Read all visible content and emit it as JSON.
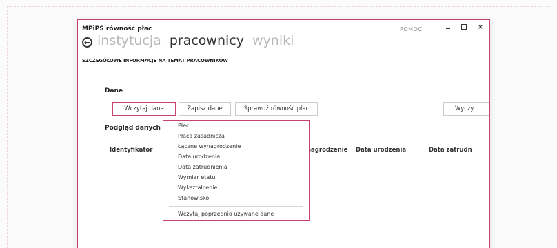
{
  "window": {
    "title": "MPiPS równość płac",
    "help": "POMOC",
    "minimize": "minimize",
    "maximize": "maximize",
    "close": "×"
  },
  "nav": {
    "back_icon": "back-arrow-icon",
    "tabs": [
      {
        "label": "instytucja",
        "state": "inactive"
      },
      {
        "label": "pracownicy",
        "state": "active"
      },
      {
        "label": "wyniki",
        "state": "inactive"
      }
    ],
    "subtitle": "SZCZEGÓŁOWE INFORMACJE NA TEMAT PRACOWNIKÓW"
  },
  "data_section": {
    "heading": "Dane",
    "buttons": {
      "load": "Wczytaj dane",
      "save": "Zapisz dane",
      "check": "Sprawdź równość płac",
      "clear": "Wyczy"
    }
  },
  "preview": {
    "heading": "Podgląd danych",
    "columns": [
      "Identyfikator",
      "nagrodzenie",
      "Data urodzenia",
      "Data zatrudn"
    ]
  },
  "dropdown": {
    "items": [
      "Płeć",
      "Płaca zasadnicza",
      "Łączne wynagrodzenie",
      "Data urodzenia",
      "Data zatrudnienia",
      "Wymiar etatu",
      "Wykształcenie",
      "Stanowisko"
    ],
    "footer_item": "Wczytaj poprzednio używane dane"
  },
  "colors": {
    "accent": "#c8426a",
    "inactive_tab": "#b8b8b8",
    "text": "#333333"
  }
}
